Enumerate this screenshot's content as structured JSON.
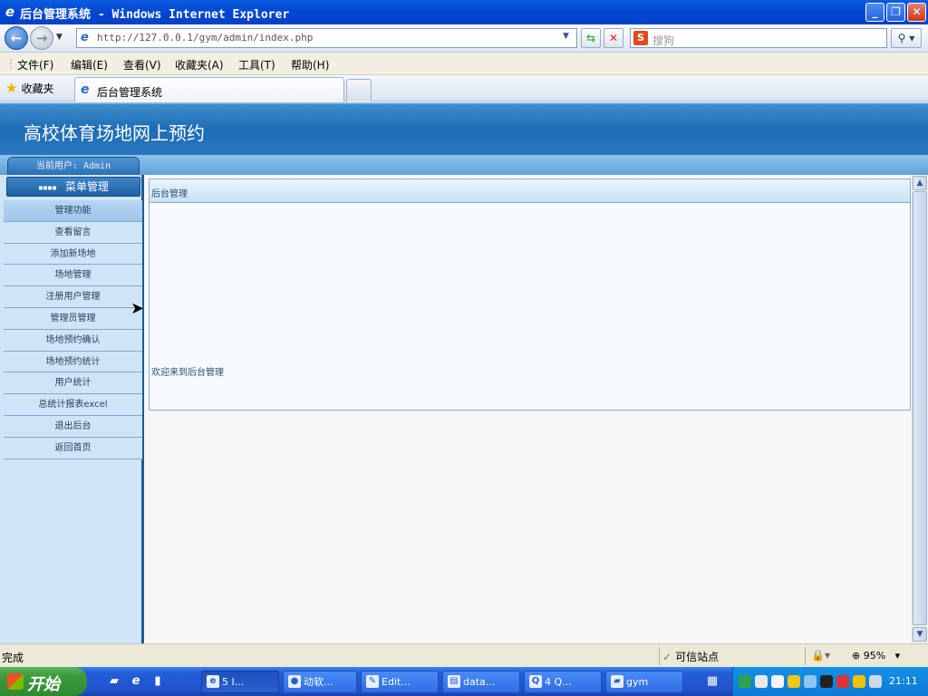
{
  "window": {
    "title": "后台管理系统 - Windows Internet Explorer"
  },
  "address_bar": {
    "url": "http://127.0.0.1/gym/admin/index.php",
    "search_placeholder": "搜狗"
  },
  "menu_bar": {
    "items": [
      "文件(F)",
      "编辑(E)",
      "查看(V)",
      "收藏夹(A)",
      "工具(T)",
      "帮助(H)"
    ]
  },
  "tabs": {
    "favorites_label": "收藏夹",
    "active_tab": "后台管理系统"
  },
  "page": {
    "banner_title": "高校体育场地网上预约",
    "current_user": "当前用户: Admin",
    "menu_header": "菜单管理",
    "nav_items": [
      "管理功能",
      "查看留言",
      "添加新场地",
      "场地管理",
      "注册用户管理",
      "管理员管理",
      "场地预约确认",
      "场地预约统计",
      "用户统计",
      "总统计报表excel",
      "退出后台",
      "返回首页"
    ],
    "main_header": "后台管理",
    "welcome_text": "欢迎来到后台管理"
  },
  "status_bar": {
    "status": "完成",
    "zone": "可信站点",
    "zoom": "95%"
  },
  "taskbar": {
    "start_label": "开始",
    "tasks": [
      "5 I...",
      "动软...",
      "Edit...",
      "data...",
      "4 Q...",
      "gym"
    ],
    "clock": "21:11"
  }
}
